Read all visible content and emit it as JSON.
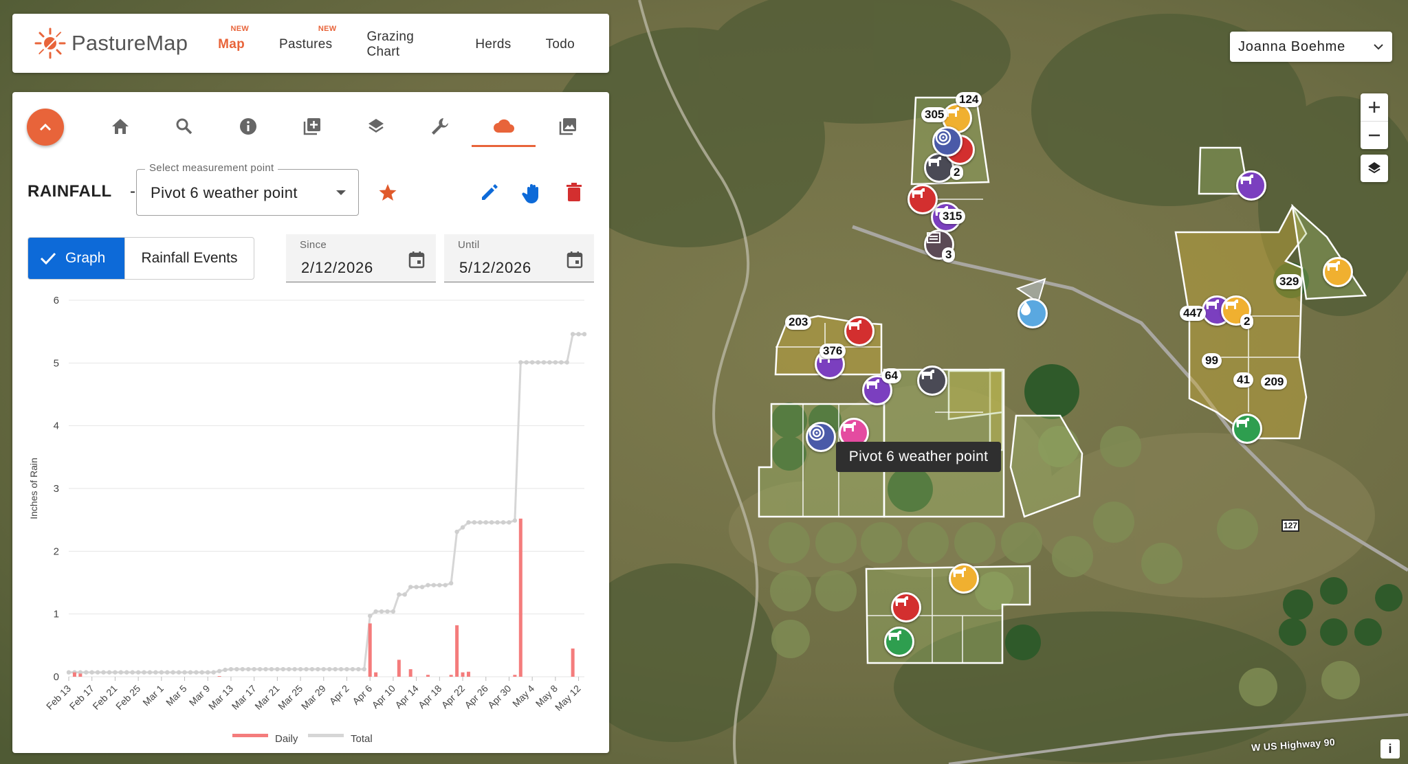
{
  "brand": {
    "name": "PastureMap",
    "accent": "#e8643a"
  },
  "nav": {
    "items": [
      {
        "label": "Map",
        "badge": "NEW",
        "active": true
      },
      {
        "label": "Pastures",
        "badge": "NEW",
        "active": false
      },
      {
        "label": "Grazing Chart",
        "badge": "",
        "active": false
      },
      {
        "label": "Herds",
        "badge": "",
        "active": false
      },
      {
        "label": "Todo",
        "badge": "",
        "active": false
      }
    ]
  },
  "user": {
    "name": "Joanna Boehme"
  },
  "toolbar": {
    "icons": [
      "home-icon",
      "search-icon",
      "info-icon",
      "add-box-icon",
      "layers-icon",
      "wrench-icon",
      "cloud-icon",
      "photo-icon"
    ],
    "active": "cloud-icon"
  },
  "rainfall": {
    "title": "RAINFALL",
    "dash": "-",
    "select_label": "Select measurement point",
    "select_value": "Pivot 6 weather point",
    "view_graph": "Graph",
    "view_events": "Rainfall Events",
    "since_label": "Since",
    "since_value": "2/12/2026",
    "until_label": "Until",
    "until_value": "5/12/2026"
  },
  "tooltip": {
    "text": "Pivot 6 weather point"
  },
  "map_labels": {
    "road_shield": "127",
    "highway": "W US Highway 90",
    "info": "i"
  },
  "colors": {
    "daily": "#f47c7c",
    "total": "#d6d6d6",
    "primary_blue": "#0d6ad8",
    "delete_red": "#d32f2f"
  },
  "chart_data": {
    "type": "bar",
    "title": "",
    "xlabel": "",
    "ylabel": "Inches of Rain",
    "ylim": [
      0,
      6
    ],
    "yticks": [
      0,
      1,
      2,
      3,
      4,
      5,
      6
    ],
    "tick_labels": [
      "Feb 13",
      "Feb 17",
      "Feb 21",
      "Feb 25",
      "Mar 1",
      "Mar 5",
      "Mar 9",
      "Mar 13",
      "Mar 17",
      "Mar 21",
      "Mar 25",
      "Mar 29",
      "Apr 2",
      "Apr 6",
      "Apr 10",
      "Apr 14",
      "Apr 18",
      "Apr 22",
      "Apr 26",
      "Apr 30",
      "May 4",
      "May 8",
      "May 12"
    ],
    "series": [
      {
        "name": "Daily",
        "kind": "bar",
        "color": "#f47c7c",
        "points": [
          [
            1,
            0.07
          ],
          [
            2,
            0.05
          ],
          [
            26,
            0.01
          ],
          [
            52,
            0.85
          ],
          [
            53,
            0.07
          ],
          [
            57,
            0.27
          ],
          [
            59,
            0.12
          ],
          [
            62,
            0.03
          ],
          [
            66,
            0.03
          ],
          [
            67,
            0.82
          ],
          [
            68,
            0.07
          ],
          [
            69,
            0.08
          ],
          [
            77,
            0.03
          ],
          [
            78,
            2.52
          ],
          [
            87,
            0.45
          ]
        ]
      },
      {
        "name": "Total",
        "kind": "line",
        "color": "#d6d6d6",
        "values": [
          0.07,
          0.07,
          0.07,
          0.07,
          0.07,
          0.07,
          0.07,
          0.07,
          0.07,
          0.07,
          0.07,
          0.07,
          0.07,
          0.07,
          0.07,
          0.07,
          0.07,
          0.07,
          0.07,
          0.07,
          0.07,
          0.07,
          0.07,
          0.07,
          0.07,
          0.07,
          0.09,
          0.11,
          0.12,
          0.12,
          0.12,
          0.12,
          0.12,
          0.12,
          0.12,
          0.12,
          0.12,
          0.12,
          0.12,
          0.12,
          0.12,
          0.12,
          0.12,
          0.12,
          0.12,
          0.12,
          0.12,
          0.12,
          0.12,
          0.12,
          0.12,
          0.12,
          0.97,
          1.04,
          1.04,
          1.04,
          1.04,
          1.31,
          1.31,
          1.43,
          1.43,
          1.43,
          1.46,
          1.46,
          1.46,
          1.46,
          1.49,
          2.31,
          2.38,
          2.46,
          2.46,
          2.46,
          2.46,
          2.46,
          2.46,
          2.46,
          2.46,
          2.49,
          5.01,
          5.01,
          5.01,
          5.01,
          5.01,
          5.01,
          5.01,
          5.01,
          5.01,
          5.46,
          5.46,
          5.46
        ]
      }
    ]
  },
  "herd_markers": [
    {
      "color": "#7b3fbf",
      "count": "376"
    },
    {
      "color": "#d32f2f",
      "count": "203"
    },
    {
      "color": "#7b3fbf",
      "count": "64"
    },
    {
      "color": "#4a4a55",
      "count": ""
    },
    {
      "color": "#e44ba0",
      "count": ""
    },
    {
      "color": "#d32f2f",
      "count": ""
    },
    {
      "color": "#f0b030",
      "count": ""
    },
    {
      "color": "#2e9e4f",
      "count": ""
    },
    {
      "color": "#7b3fbf",
      "count": "447"
    },
    {
      "color": "#f0b030",
      "count": "2"
    },
    {
      "color": "#f0b030",
      "count": "329"
    },
    {
      "color": "#7b3fbf",
      "count": ""
    },
    {
      "color": "#2e9e4f",
      "count": ""
    },
    {
      "color": "#7b3fbf",
      "count": "315"
    },
    {
      "color": "#d32f2f",
      "count": ""
    },
    {
      "color": "#4a4a55",
      "count": "2"
    },
    {
      "color": "#f0b030",
      "count": "305"
    }
  ],
  "map_counts": [
    "124",
    "3",
    "99",
    "41",
    "209"
  ]
}
